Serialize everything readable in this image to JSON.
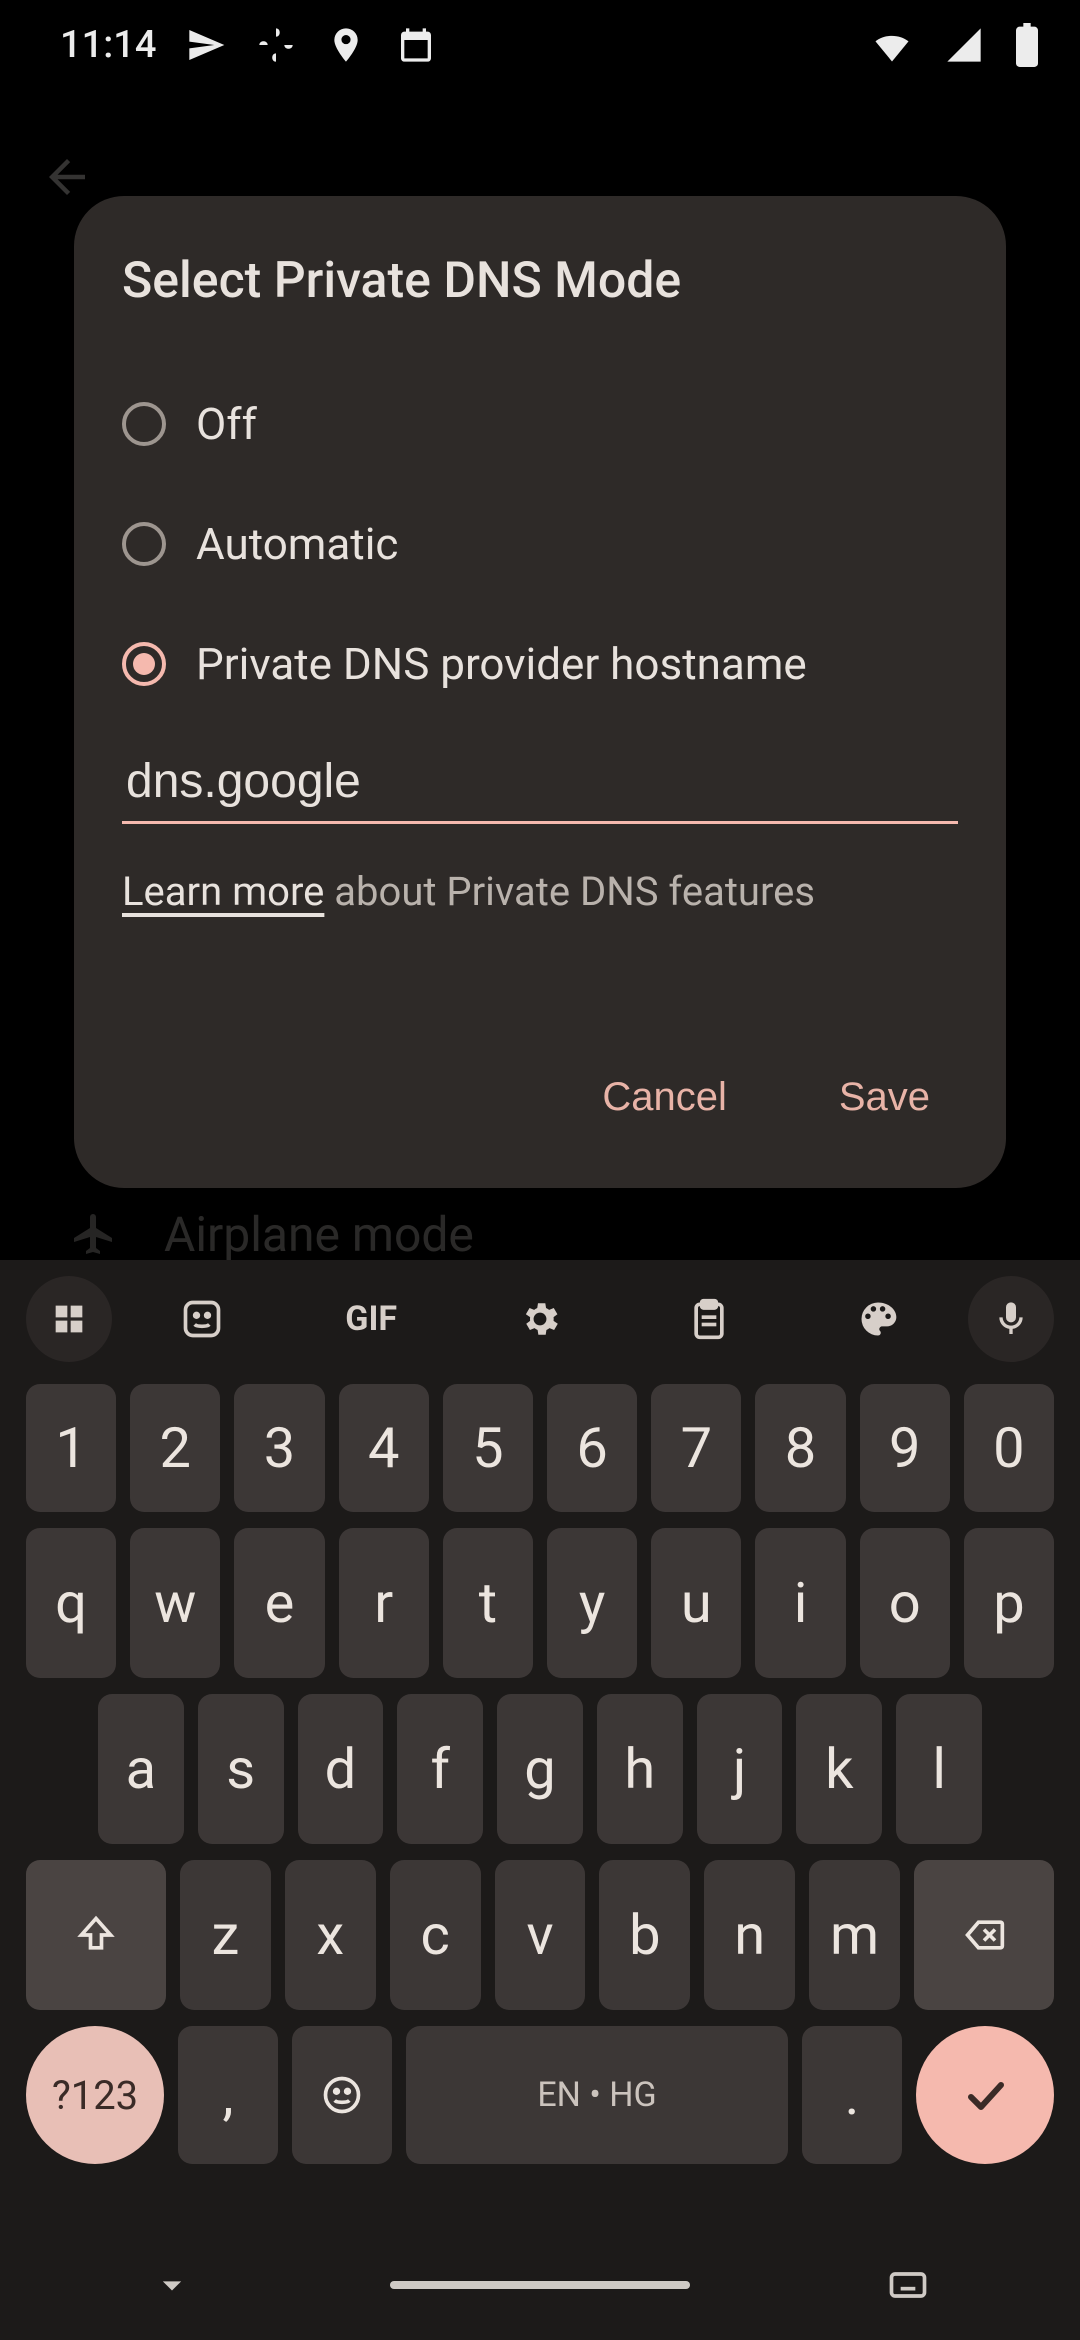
{
  "status": {
    "time": "11:14",
    "icons_left": [
      "send-icon",
      "pinwheel-icon",
      "location-icon",
      "calendar-icon"
    ],
    "icons_right": [
      "wifi-icon",
      "signal-icon",
      "battery-icon"
    ]
  },
  "background": {
    "airplane_label": "Airplane mode"
  },
  "dialog": {
    "title": "Select Private DNS Mode",
    "options": {
      "off": "Off",
      "automatic": "Automatic",
      "hostname": "Private DNS provider hostname"
    },
    "selected": "hostname",
    "input_value": "dns.google",
    "learn_more": "Learn more",
    "learn_more_suffix": " about Private DNS features",
    "cancel": "Cancel",
    "save": "Save"
  },
  "keyboard": {
    "row1": [
      "1",
      "2",
      "3",
      "4",
      "5",
      "6",
      "7",
      "8",
      "9",
      "0"
    ],
    "row2": [
      "q",
      "w",
      "e",
      "r",
      "t",
      "y",
      "u",
      "i",
      "o",
      "p"
    ],
    "row3": [
      "a",
      "s",
      "d",
      "f",
      "g",
      "h",
      "j",
      "k",
      "l"
    ],
    "row4": [
      "z",
      "x",
      "c",
      "v",
      "b",
      "n",
      "m"
    ],
    "sym": "?123",
    "space": "EN • HG",
    "comma": ",",
    "dot": "."
  }
}
